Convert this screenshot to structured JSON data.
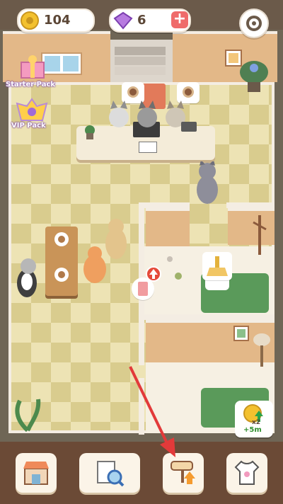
{
  "hud": {
    "coins": "104",
    "gems": "6",
    "plus_symbol": "+"
  },
  "side_items": {
    "starter_pack": "Starter Pack",
    "vip_pack": "VIP Pack"
  },
  "boost": {
    "multiplier": "x2",
    "duration": "+5m"
  },
  "bottom_nav": [
    {
      "name": "shop-button",
      "icon": "store-icon"
    },
    {
      "name": "inspect-button",
      "icon": "magnifier-newspaper-icon"
    },
    {
      "name": "renovate-button",
      "icon": "paint-roller-icon"
    },
    {
      "name": "wardrobe-button",
      "icon": "shirt-icon"
    }
  ],
  "colors": {
    "floor_check": "#d9cc8e",
    "wall": "#e3b888",
    "accent_red": "#ef6b6b",
    "arrow_red": "#e23a3a",
    "bed_green": "#5a9a5a"
  }
}
